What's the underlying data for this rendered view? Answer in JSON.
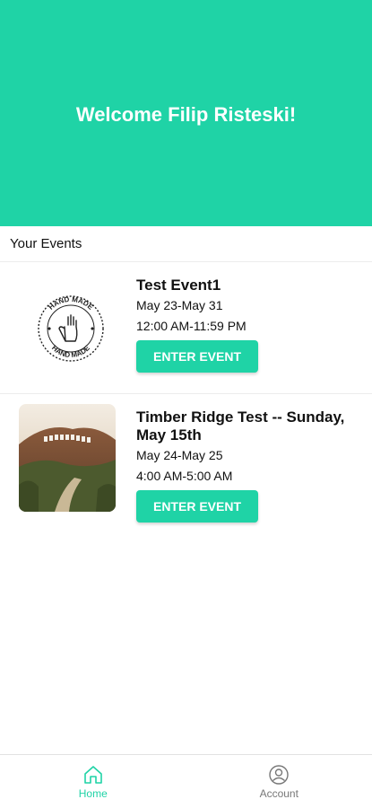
{
  "header": {
    "welcome": "Welcome Filip Risteski!"
  },
  "section": {
    "title": "Your Events"
  },
  "events": [
    {
      "title": "Test Event1",
      "dates": "May 23-May 31",
      "time": "12:00 AM-11:59 PM",
      "button": "ENTER EVENT",
      "thumbnail": "hand-made-stamp-logo"
    },
    {
      "title": "Timber Ridge Test -- Sunday, May 15th",
      "dates": "May 24-May 25",
      "time": "4:00 AM-5:00 AM",
      "button": "ENTER EVENT",
      "thumbnail": "hollywood-sign-photo"
    }
  ],
  "stamp": {
    "text": "HAND MADE"
  },
  "nav": {
    "home": {
      "label": "Home",
      "icon": "home-icon"
    },
    "account": {
      "label": "Account",
      "icon": "account-icon"
    }
  },
  "colors": {
    "accent": "#1fd3a6",
    "text": "#111111",
    "muted": "#777777"
  }
}
